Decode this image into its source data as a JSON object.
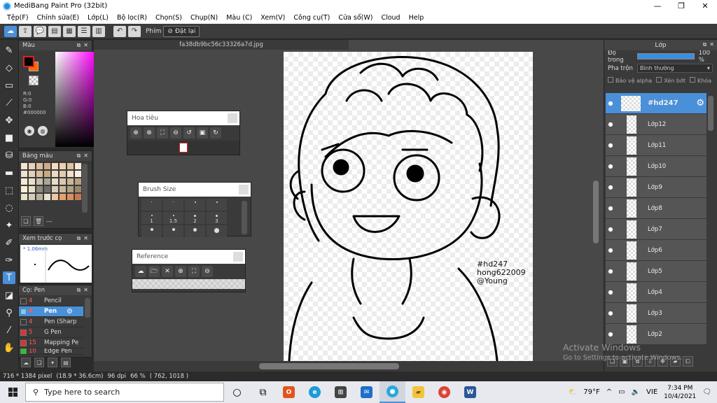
{
  "titlebar": {
    "title": "MediBang Paint Pro (32bit)",
    "minimize": "—",
    "maximize": "❐",
    "close": "✕"
  },
  "menubar": [
    "Tệp(F)",
    "Chỉnh sửa(E)",
    "Lớp(L)",
    "Bộ lọc(R)",
    "Chọn(S)",
    "Chụp(N)",
    "Màu (C)",
    "Xem(V)",
    "Công cụ(T)",
    "Cửa sổ(W)",
    "Cloud",
    "Help"
  ],
  "toolbar": {
    "label": "Phím",
    "reset_label": "Đặt lại"
  },
  "color_panel": {
    "title": "Màu",
    "r": "R:0",
    "g": "G:0",
    "b": "B:0",
    "hex": "#000000"
  },
  "palette_panel": {
    "title": "Bảng màu",
    "footer_text": "---",
    "colors": [
      "#f5e6d3",
      "#e8d2b8",
      "#d9bfa0",
      "#cfa98a",
      "#f3dcc2",
      "#ead0b0",
      "#e0c2a0",
      "#f8e8d8",
      "#efe1cf",
      "#e4cfb6",
      "#d8bc9c",
      "#c9a880",
      "#eadbc6",
      "#decbb0",
      "#f2dfc8",
      "#fbeee0",
      "#f7ead5",
      "#ece0c7",
      "#c4c0ae",
      "#a8a696",
      "#e8dcc4",
      "#d8c8ae",
      "#cbb696",
      "#b8a080",
      "#f6f0d8",
      "#e6e0c6",
      "#8c8c7e",
      "#6e6e66",
      "#d8cdb6",
      "#c8b99e",
      "#b0a080",
      "#98886a",
      "#ece2cc",
      "#d6cdb8",
      "#b8b09c",
      "#e9e4d2",
      "#f0c8a0",
      "#e8a070",
      "#d89060",
      "#c87850"
    ]
  },
  "preview_panel": {
    "title": "Xem trước cọ",
    "size": "* 1.06mm"
  },
  "brush_panel": {
    "title": "Cọ: Pen",
    "brushes": [
      {
        "size": "4",
        "name": "Pencil",
        "color": "#3a3a3a"
      },
      {
        "size": "4",
        "name": "Pen",
        "color": "#6ad0ff",
        "selected": true
      },
      {
        "size": "4",
        "name": "Pen (Sharp",
        "color": "#3a3a3a"
      },
      {
        "size": "5",
        "name": "G Pen",
        "color": "#e03030"
      },
      {
        "size": "15",
        "name": "Mapping Pe",
        "color": "#e03030"
      },
      {
        "size": "10",
        "name": "Edge Pen",
        "color": "#30c030"
      }
    ]
  },
  "canvas": {
    "tab_title": "fa38db9bc56c33326a7d.jpg",
    "signature_lines": [
      "#hd247",
      "hong622009",
      "@Young"
    ]
  },
  "navigator": {
    "title": "Hoa tiêu"
  },
  "brush_size_window": {
    "title": "Brush Size",
    "labels": [
      "",
      "",
      "",
      "",
      "1",
      "1.5",
      "2",
      "3",
      "",
      "",
      "",
      ""
    ]
  },
  "reference_window": {
    "title": "Reference"
  },
  "layer_panel": {
    "title": "Lớp",
    "opacity_label": "Độ trong",
    "opacity_value": "100 %",
    "blend_label": "Pha trộn",
    "blend_value": "Bình thường",
    "protect_alpha": "Bảo vệ alpha",
    "clipping": "Xén bớt",
    "lock": "Khóa",
    "layers": [
      {
        "name": "#hd247",
        "selected": true
      },
      {
        "name": "Lớp12"
      },
      {
        "name": "Lớp11"
      },
      {
        "name": "Lớp10"
      },
      {
        "name": "Lớp9"
      },
      {
        "name": "Lớp8"
      },
      {
        "name": "Lớp7"
      },
      {
        "name": "Lớp6"
      },
      {
        "name": "Lớp5"
      },
      {
        "name": "Lớp4"
      },
      {
        "name": "Lớp3"
      },
      {
        "name": "Lớp2"
      }
    ]
  },
  "watermark": {
    "line1": "Activate Windows",
    "line2": "Go to Settings to activate Windows."
  },
  "statusbar": {
    "dimensions": "716 * 1384 pixel",
    "cm": "(18.9 * 36.6cm)",
    "dpi": "96 dpi",
    "zoom": "66 %",
    "coords": "( 762, 1018 )"
  },
  "taskbar": {
    "search_placeholder": "Type here to search",
    "weather": "79°F",
    "language": "VIE",
    "time": "7:34 PM",
    "date": "10/4/2021"
  }
}
